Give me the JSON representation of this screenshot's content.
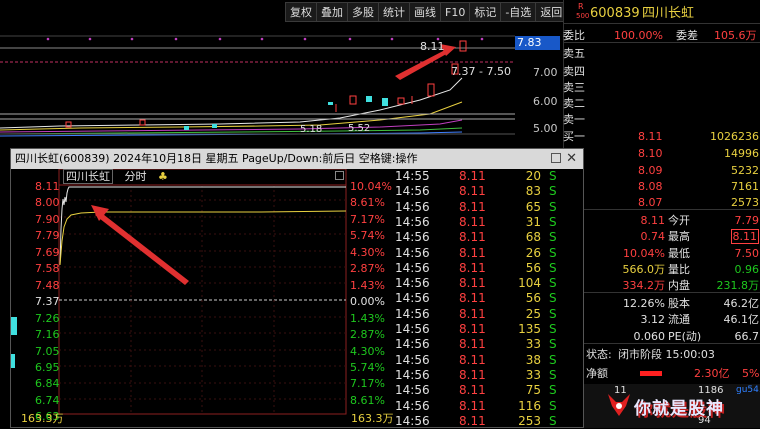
{
  "toolbar": [
    "复权",
    "叠加",
    "多股",
    "统计",
    "画线",
    "F10",
    "标记",
    "-自选",
    "返回"
  ],
  "main_chart": {
    "price_labels": [
      "8.11",
      "7.37 - 7.50",
      "5.18",
      "5.52"
    ],
    "current_price": "7.83",
    "axis": [
      "7.00",
      "6.00",
      "5.00"
    ]
  },
  "right_panel": {
    "stock_code": "600839",
    "stock_name": "四川长虹",
    "badge_top": "R",
    "badge_bottom": "500",
    "wei_bi_label": "委比",
    "wei_bi": "100.00%",
    "wei_cha_label": "委差",
    "wei_cha": "105.6万",
    "sell_labels": [
      "卖五",
      "卖四",
      "卖三",
      "卖二",
      "卖一"
    ],
    "buy_label": "买一",
    "bids": [
      {
        "price": "8.11",
        "vol": "1026236"
      },
      {
        "price": "8.10",
        "vol": "14996"
      },
      {
        "price": "8.09",
        "vol": "5232"
      },
      {
        "price": "8.08",
        "vol": "7161"
      },
      {
        "price": "8.07",
        "vol": "2573"
      }
    ],
    "stats": [
      {
        "v1": "8.11",
        "l1": "今开",
        "v2": "7.79"
      },
      {
        "v1": "0.74",
        "l1": "最高",
        "v2": "8.11"
      },
      {
        "v1": "10.04%",
        "l1": "最低",
        "v2": "7.50"
      },
      {
        "v1": "566.0万",
        "l1": "量比",
        "v2": "0.96"
      },
      {
        "v1": "334.2万",
        "l1": "内盘",
        "v2": "231.8万"
      },
      {
        "v1": "12.26%",
        "l1": "股本",
        "v2": "46.2亿"
      },
      {
        "v1": "3.12",
        "l1": "流通",
        "v2": "46.1亿"
      },
      {
        "v1": "0.060",
        "l1": "PE(动)",
        "v2": "66.7"
      }
    ],
    "status_label": "状态:",
    "status": "闭市阶段 15:00:03",
    "net_label": "净额",
    "net_value": "2.30亿",
    "net_pct": "5%",
    "bottom_rows": [
      "11",
      "1186",
      "94"
    ],
    "watermark": "你就是股神",
    "watermark_site": "gu54.cn"
  },
  "popup": {
    "title": "四川长虹(600839)  2024年10月18日 星期五 PageUp/Down:前后日 空格键:操作",
    "stock_name": "四川长虹",
    "mode": "分时",
    "price_axis": [
      "8.11",
      "8.00",
      "7.90",
      "7.79",
      "7.69",
      "7.58",
      "7.48",
      "7.37",
      "7.26",
      "7.16",
      "7.05",
      "6.95",
      "6.84",
      "6.74",
      "6.63"
    ],
    "pct_axis": [
      "10.04%",
      "8.61%",
      "7.17%",
      "5.74%",
      "4.30%",
      "2.87%",
      "1.43%",
      "0.00%",
      "1.43%",
      "2.87%",
      "4.30%",
      "5.74%",
      "7.17%",
      "8.61%"
    ],
    "volume_label": "163.3万",
    "ticks": [
      [
        "14:55",
        "8.11",
        "20",
        "S"
      ],
      [
        "14:56",
        "8.11",
        "83",
        "S"
      ],
      [
        "14:56",
        "8.11",
        "65",
        "S"
      ],
      [
        "14:56",
        "8.11",
        "31",
        "S"
      ],
      [
        "14:56",
        "8.11",
        "68",
        "S"
      ],
      [
        "14:56",
        "8.11",
        "26",
        "S"
      ],
      [
        "14:56",
        "8.11",
        "56",
        "S"
      ],
      [
        "14:56",
        "8.11",
        "104",
        "S"
      ],
      [
        "14:56",
        "8.11",
        "56",
        "S"
      ],
      [
        "14:56",
        "8.11",
        "25",
        "S"
      ],
      [
        "14:56",
        "8.11",
        "135",
        "S"
      ],
      [
        "14:56",
        "8.11",
        "33",
        "S"
      ],
      [
        "14:56",
        "8.11",
        "38",
        "S"
      ],
      [
        "14:56",
        "8.11",
        "33",
        "S"
      ],
      [
        "14:56",
        "8.11",
        "75",
        "S"
      ],
      [
        "14:56",
        "8.11",
        "116",
        "S"
      ],
      [
        "14:56",
        "8.11",
        "253",
        "S"
      ]
    ]
  }
}
